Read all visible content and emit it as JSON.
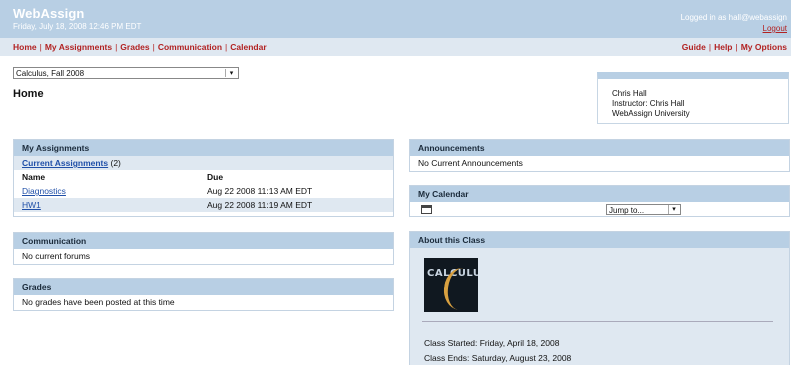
{
  "header": {
    "logo_prefix": "Web",
    "logo_suffix": "Assign",
    "datetime": "Friday, July 18, 2008 12:46 PM EDT",
    "logged_in": "Logged in as hall@webassign",
    "logout": "Logout"
  },
  "nav": {
    "left": [
      "Home",
      "My Assignments",
      "Grades",
      "Communication",
      "Calendar"
    ],
    "right": [
      "Guide",
      "Help",
      "My Options"
    ]
  },
  "course_select": {
    "value": "Calculus, Fall 2008"
  },
  "page_title": "Home",
  "user": {
    "name": "Chris Hall",
    "role": "Instructor: Chris Hall",
    "school": "WebAssign University"
  },
  "assignments": {
    "title": "My Assignments",
    "current_link": "Current Assignments",
    "current_count": "(2)",
    "col_name": "Name",
    "col_due": "Due",
    "rows": [
      {
        "name": "Diagnostics",
        "due": "Aug 22 2008 11:13 AM EDT"
      },
      {
        "name": "HW1",
        "due": "Aug 22 2008 11:19 AM EDT"
      }
    ]
  },
  "communication": {
    "title": "Communication",
    "text": "No current forums"
  },
  "grades": {
    "title": "Grades",
    "text": "No grades have been posted at this time"
  },
  "announcements": {
    "title": "Announcements",
    "text": "No Current Announcements"
  },
  "calendar": {
    "title": "My Calendar",
    "jump_to": "Jump to..."
  },
  "about": {
    "title": "About this Class",
    "book_title": "CALCULUS",
    "started": "Class Started: Friday, April 18, 2008",
    "ends": "Class Ends: Saturday, August 23, 2008"
  },
  "colors": {
    "header_bg": "#b8cfe4",
    "nav_bg": "#dfe8f1",
    "nav_link": "#b22222",
    "link": "#1f4fa8"
  }
}
